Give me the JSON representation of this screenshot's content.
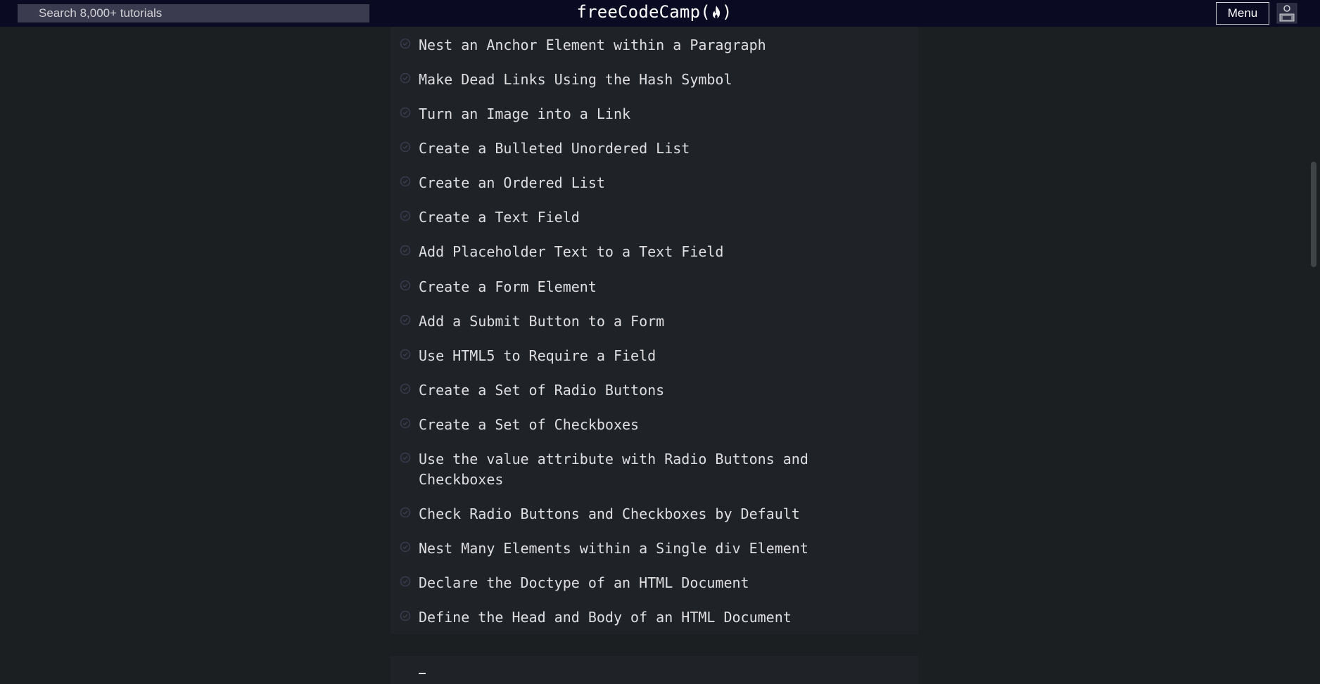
{
  "search": {
    "placeholder": "Search 8,000+ tutorials"
  },
  "logo": {
    "text_left": "freeCodeCamp(",
    "text_right": ")"
  },
  "nav": {
    "menu_label": "Menu"
  },
  "lessons": [
    {
      "title": "Nest an Anchor Element within a Paragraph",
      "completed": true
    },
    {
      "title": "Make Dead Links Using the Hash Symbol",
      "completed": true
    },
    {
      "title": "Turn an Image into a Link",
      "completed": true
    },
    {
      "title": "Create a Bulleted Unordered List",
      "completed": true
    },
    {
      "title": "Create an Ordered List",
      "completed": true
    },
    {
      "title": "Create a Text Field",
      "completed": true
    },
    {
      "title": "Add Placeholder Text to a Text Field",
      "completed": true
    },
    {
      "title": "Create a Form Element",
      "completed": true
    },
    {
      "title": "Add a Submit Button to a Form",
      "completed": true
    },
    {
      "title": "Use HTML5 to Require a Field",
      "completed": true
    },
    {
      "title": "Create a Set of Radio Buttons",
      "completed": true
    },
    {
      "title": "Create a Set of Checkboxes",
      "completed": true
    },
    {
      "title": "Use the value attribute with Radio Buttons and Checkboxes",
      "completed": true
    },
    {
      "title": "Check Radio Buttons and Checkboxes by Default",
      "completed": true
    },
    {
      "title": "Nest Many Elements within a Single div Element",
      "completed": true
    },
    {
      "title": "Declare the Doctype of an HTML Document",
      "completed": true
    },
    {
      "title": "Define the Head and Body of an HTML Document",
      "completed": true
    }
  ],
  "colors": {
    "navbar_bg": "#0a0a23",
    "page_bg": "#1b1f21",
    "panel_bg": "#1f2226",
    "text": "#dfdfe2",
    "check_icon": "#3b3b4f"
  },
  "icons": {
    "lesson_status": "check-circle-icon",
    "logo_flame": "flame-icon",
    "avatar": "avatar-icon"
  }
}
